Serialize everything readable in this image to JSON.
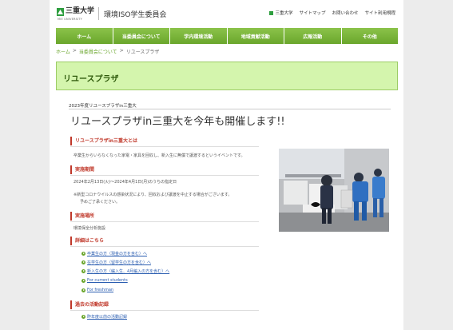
{
  "header": {
    "logo_jp": "三重大学",
    "logo_en": "MIE UNIVERSITY",
    "site_title": "環境ISO学生委員会",
    "util": {
      "mini_logo": "三重大学",
      "sitemap": "サイトマップ",
      "contact": "お問い合わせ",
      "policy": "サイト利用規程"
    },
    "logo_icon": "book-leaf-icon",
    "brand_color": "#2e9e3f"
  },
  "nav": {
    "items": [
      "ホーム",
      "当委員会について",
      "学内環境活動",
      "地域貢献活動",
      "広報活動",
      "その他"
    ],
    "color": "#6aa62c"
  },
  "breadcrumb": {
    "home": "ホーム",
    "sep1": ">",
    "about": "当委員会について",
    "sep2": ">",
    "current": "リユースプラザ"
  },
  "page_header": {
    "title": "リユースプラザ",
    "bg": "#d4f5ad"
  },
  "article": {
    "year_label": "2023年度リユースプラザin三重大",
    "title": "リユースプラザin三重大を今年も開催します!!",
    "sections": {
      "about": {
        "heading": "リユースプラザin三重大とは",
        "text": "卒業生からいらなくなった家電・家具を回収し、新入生に無償で譲渡するというイベントです。"
      },
      "period": {
        "heading": "実施期間",
        "text": "2024年2月13日(火)〜2024年4月1日(月)のうちの指定日",
        "note1": "※新型コロナウイルスの感染状況により、回収および譲渡を中止する場合がございます。",
        "note2": "予めご了承ください。"
      },
      "place": {
        "heading": "実施場所",
        "text": "環境保全分析施設"
      },
      "details": {
        "heading": "詳細はこちら",
        "links": [
          "卒業生の方（現金の方を含む）へ",
          "在学生の方（留学生の方を含む）へ",
          "新入生の方（編入生、4月編入の方を含む）へ",
          "For current students",
          "For freshman"
        ]
      },
      "past": {
        "heading": "過去の活動記録",
        "links": [
          "昨年度以前の活動記録"
        ]
      }
    },
    "accent_color": "#c0392b",
    "link_color": "#2a5db0"
  }
}
